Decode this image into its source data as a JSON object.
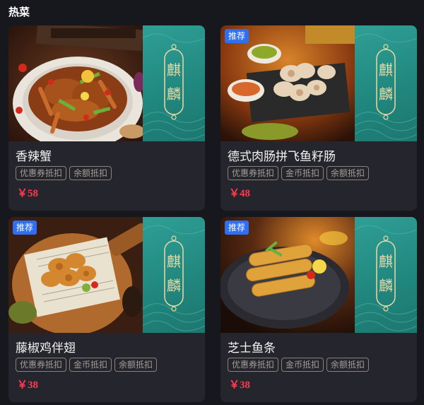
{
  "section": {
    "title": "热菜"
  },
  "brand": {
    "chars": [
      "麒",
      "麟"
    ],
    "panel_color": "#21887f",
    "accent_color": "#e9d9a6"
  },
  "price_color": "#ff3b4f",
  "badge_color": "#2f6ff0",
  "dishes": [
    {
      "name": "香辣蟹",
      "badge": "",
      "tags": [
        "优惠券抵扣",
        "余额抵扣"
      ],
      "price": "￥58"
    },
    {
      "name": "德式肉肠拼飞鱼籽肠",
      "badge": "推荐",
      "tags": [
        "优惠券抵扣",
        "金币抵扣",
        "余额抵扣"
      ],
      "price": "￥48"
    },
    {
      "name": "藤椒鸡伴翅",
      "badge": "推荐",
      "tags": [
        "优惠券抵扣",
        "金币抵扣",
        "余额抵扣"
      ],
      "price": "￥38"
    },
    {
      "name": "芝士鱼条",
      "badge": "推荐",
      "tags": [
        "优惠券抵扣",
        "金币抵扣",
        "余额抵扣"
      ],
      "price": "￥38"
    }
  ]
}
